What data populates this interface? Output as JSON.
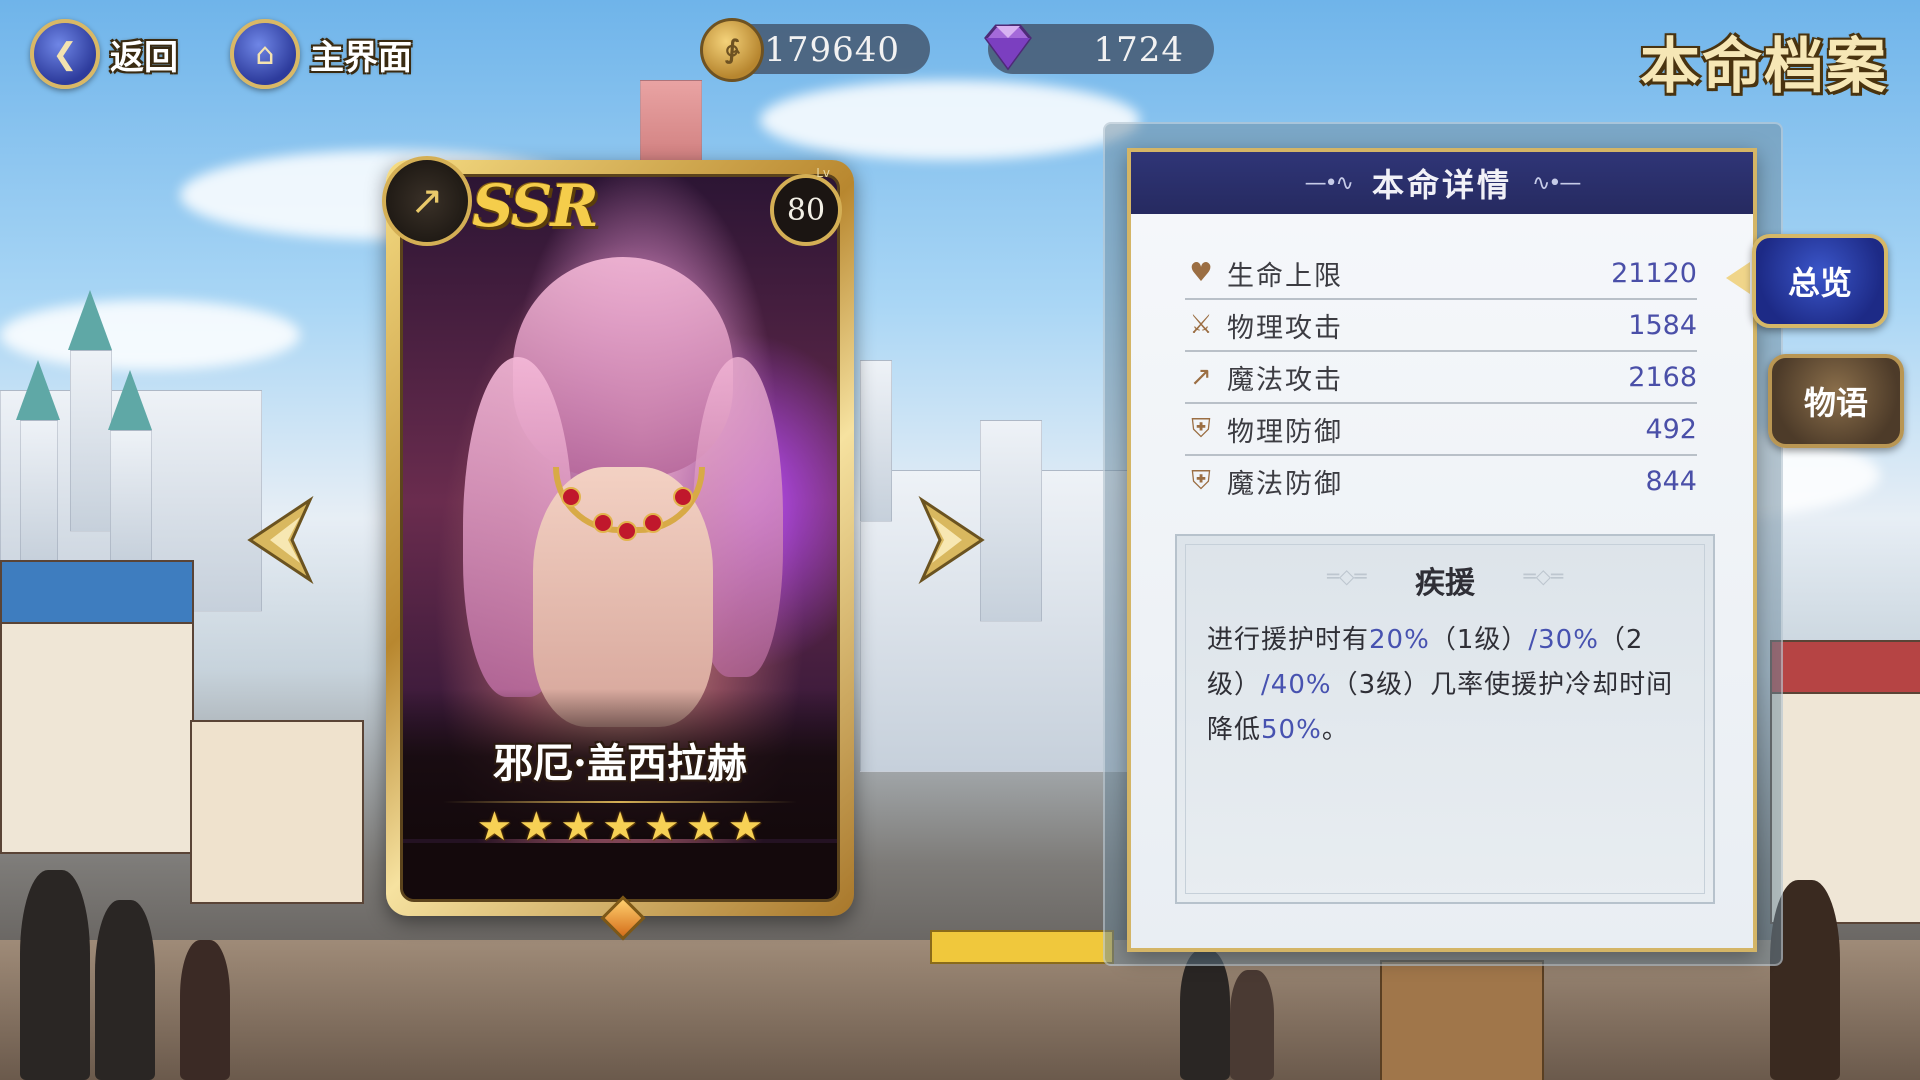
{
  "nav": {
    "back_label": "返回",
    "home_label": "主界面"
  },
  "currency": {
    "gold": "179640",
    "gems": "1724"
  },
  "screen_title": "本命档案",
  "card": {
    "rarity": "SSR",
    "level_tag": "Lv",
    "level": "80",
    "name": "邪厄·盖西拉赫",
    "stars": 7
  },
  "panel": {
    "title": "本命详情",
    "stats": [
      {
        "label": "生命上限",
        "value": "21120",
        "icon": "heart-icon"
      },
      {
        "label": "物理攻击",
        "value": "1584",
        "icon": "sword-icon"
      },
      {
        "label": "魔法攻击",
        "value": "2168",
        "icon": "wand-icon"
      },
      {
        "label": "物理防御",
        "value": "492",
        "icon": "shield-sword-icon"
      },
      {
        "label": "魔法防御",
        "value": "844",
        "icon": "shield-wand-icon"
      }
    ],
    "skill": {
      "name": "疾援",
      "text_parts": [
        {
          "t": "进行援护时有",
          "hl": false
        },
        {
          "t": "20%",
          "hl": true
        },
        {
          "t": "（1级）",
          "hl": false
        },
        {
          "t": "/30%",
          "hl": true
        },
        {
          "t": "（2级）",
          "hl": false
        },
        {
          "t": "/40%",
          "hl": true
        },
        {
          "t": "（3级）",
          "hl": false
        },
        {
          "t": "几率使援护冷却时间降低",
          "hl": false
        },
        {
          "t": "50%",
          "hl": true
        },
        {
          "t": "。",
          "hl": false
        }
      ]
    }
  },
  "tabs": {
    "overview": "总览",
    "story": "物语"
  }
}
